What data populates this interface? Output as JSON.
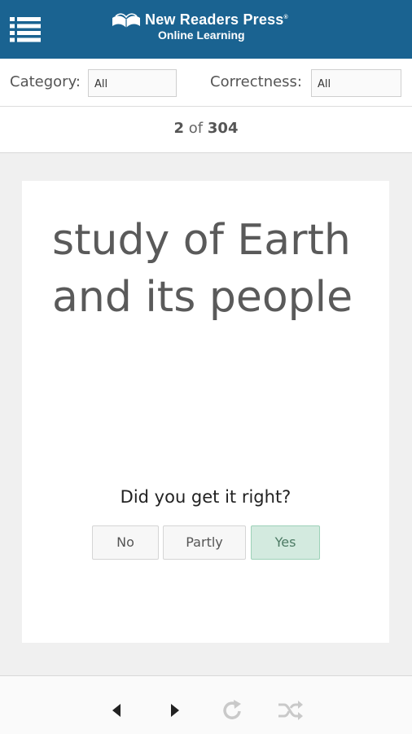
{
  "header": {
    "brand_line1": "New Readers Press",
    "brand_reg": "®",
    "brand_line2": "Online Learning",
    "bg_color": "#1a6391"
  },
  "filters": {
    "category_label": "Category:",
    "category_value": "All",
    "correctness_label": "Correctness:",
    "correctness_value": "All"
  },
  "counter": {
    "current": "2",
    "of_text": "of",
    "total": "304"
  },
  "card": {
    "term": "study of Earth and its people",
    "question": "Did you get it right?",
    "answers": {
      "no": "No",
      "partly": "Partly",
      "yes": "Yes"
    },
    "selected_answer": "Yes"
  },
  "bottom_nav": {
    "icons": [
      "previous-icon",
      "next-icon",
      "redo-icon",
      "shuffle-icon"
    ]
  }
}
